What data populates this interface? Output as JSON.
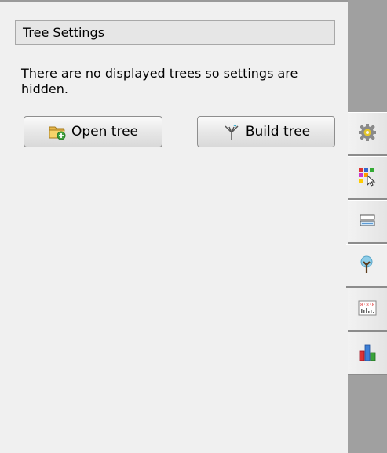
{
  "panel": {
    "title": "Tree Settings",
    "message": "There are no displayed trees so settings are hidden."
  },
  "buttons": {
    "open_tree": "Open tree",
    "build_tree": "Build tree"
  },
  "side_tabs": [
    {
      "icon": "gear-icon"
    },
    {
      "icon": "color-grid-cursor-icon"
    },
    {
      "icon": "rows-icon"
    },
    {
      "icon": "tree-icon",
      "active": true
    },
    {
      "icon": "sequence-data-icon"
    },
    {
      "icon": "bar-chart-icon"
    }
  ],
  "colors": {
    "tab_strip": "#a0a0a0",
    "panel_bg": "#f0f0f0"
  }
}
